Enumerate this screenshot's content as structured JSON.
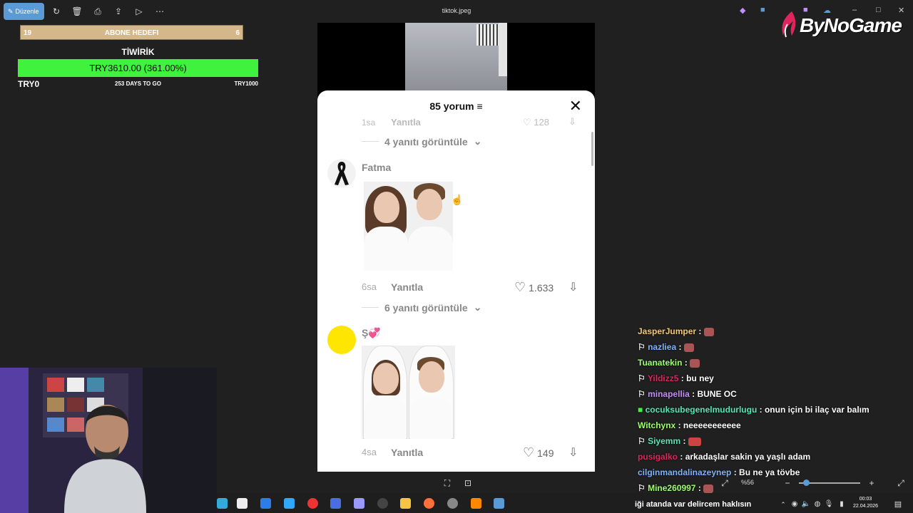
{
  "viewer": {
    "edit_label": "Düzenle",
    "file_title": "tiktok.jpeg",
    "zoom": "%56"
  },
  "overlay": {
    "sub_goal": {
      "left": "19",
      "title": "ABONE HEDEFI",
      "right": "6"
    },
    "donation": {
      "title": "TİWİRİK",
      "amount": "TRY3610.00 (361.00%)",
      "min": "TRY0",
      "days": "253 DAYS TO GO",
      "max": "TRY1000"
    },
    "logo": "ByNoGame"
  },
  "tiktok": {
    "comments_title": "85 yorum",
    "top_partial": {
      "time": "1sa",
      "reply": "Yanıtla",
      "likes": "128"
    },
    "replies1": "4 yanıtı görüntüle",
    "comment1": {
      "user": "Fatma",
      "time": "6sa",
      "reply": "Yanıtla",
      "likes": "1.633",
      "replies": "6 yanıtı görüntüle"
    },
    "comment2": {
      "user": "Ş💞",
      "time": "4sa",
      "reply": "Yanıtla",
      "likes": "149"
    }
  },
  "chat": [
    {
      "user": "JasperJumper",
      "color": "#f7c96b",
      "msg": ""
    },
    {
      "user": "nazliea",
      "color": "#7fb3ff",
      "msg": ""
    },
    {
      "user": "Tuanatekin",
      "color": "#9cff6b",
      "msg": ""
    },
    {
      "user": "Yildizz5",
      "color": "#e0245e",
      "msg": "bu ney"
    },
    {
      "user": "minapellia",
      "color": "#c58cff",
      "msg": "BUNE OC"
    },
    {
      "user": "cocuksubegenelmudurlugu",
      "color": "#57e6b8",
      "msg": "onun için bi ilaç var balım"
    },
    {
      "user": "Witchynx",
      "color": "#9cff6b",
      "msg": "neeeeeeeeeee"
    },
    {
      "user": "Siyemm",
      "color": "#57e6b8",
      "msg": ""
    },
    {
      "user": "pusigalko",
      "color": "#e0245e",
      "msg": "arkadaşlar sakin ya yaşlı adam"
    },
    {
      "user": "cilginmandalinazeynep",
      "color": "#7fb3ff",
      "msg": "Bu ne ya tövbe"
    },
    {
      "user": "Mine260997",
      "color": "#9cff6b",
      "msg": ""
    }
  ],
  "ticker": "iği atanda var delircem haklısın",
  "clock": {
    "time": "00:03",
    "date": "22.04.2026"
  }
}
